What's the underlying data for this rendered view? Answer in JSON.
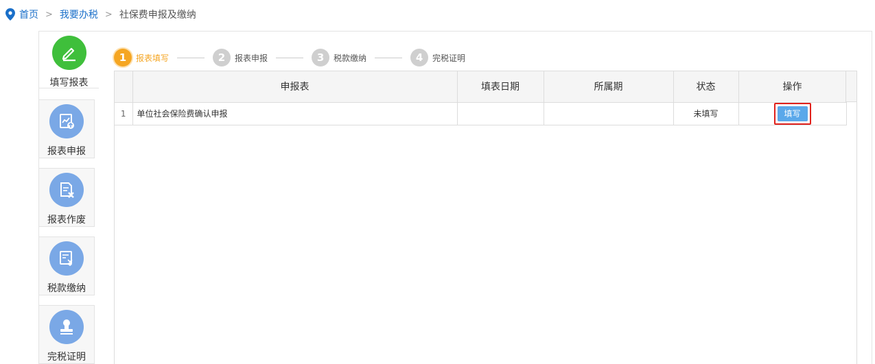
{
  "breadcrumb": {
    "icon": "location-pin-icon",
    "items": [
      "首页",
      "我要办税",
      "社保费申报及缴纳"
    ]
  },
  "side_menu": [
    {
      "label": "填写报表",
      "icon": "pencil-icon",
      "active": true
    },
    {
      "label": "报表申报",
      "icon": "report-upload-icon",
      "active": false
    },
    {
      "label": "报表作废",
      "icon": "report-cancel-icon",
      "active": false
    },
    {
      "label": "税款缴纳",
      "icon": "tax-payment-icon",
      "active": false
    },
    {
      "label": "完税证明",
      "icon": "stamp-certificate-icon",
      "active": false
    }
  ],
  "steps": [
    {
      "num": "1",
      "label": "报表填写",
      "active": true
    },
    {
      "num": "2",
      "label": "报表申报",
      "active": false
    },
    {
      "num": "3",
      "label": "税款缴纳",
      "active": false
    },
    {
      "num": "4",
      "label": "完税证明",
      "active": false
    }
  ],
  "table": {
    "headers": [
      "",
      "申报表",
      "填表日期",
      "所属期",
      "状态",
      "操作"
    ],
    "rows": [
      {
        "index": "1",
        "name": "单位社会保险费确认申报",
        "date": "",
        "period": "",
        "status": "未填写",
        "action": "填写"
      }
    ]
  },
  "colors": {
    "link": "#1a6fc9",
    "active_step": "#f5a623",
    "button": "#5aa8ea",
    "highlight_border": "#e0201b",
    "green_icon": "#3fbf3b",
    "blue_icon": "#7aa8e6"
  }
}
